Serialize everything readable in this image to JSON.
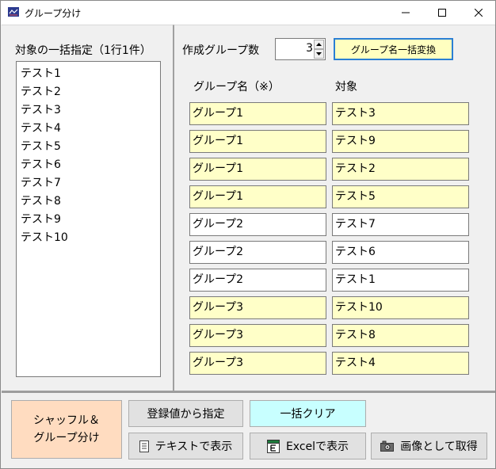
{
  "window": {
    "title": "グループ分け",
    "icon": "app-icon",
    "controls": [
      "minimize-icon",
      "maximize-icon",
      "close-icon"
    ]
  },
  "left": {
    "heading": "対象の一括指定（1行1件）",
    "items": [
      "テスト1",
      "テスト2",
      "テスト3",
      "テスト4",
      "テスト5",
      "テスト6",
      "テスト7",
      "テスト8",
      "テスト9",
      "テスト10"
    ]
  },
  "right": {
    "count_label": "作成グループ数",
    "count_value": "3",
    "convert_button": "グループ名一括変換",
    "col_group": "グループ名（※）",
    "col_target": "対象",
    "rows": [
      {
        "group": "グループ1",
        "target": "テスト3",
        "color": "yellow"
      },
      {
        "group": "グループ1",
        "target": "テスト9",
        "color": "yellow"
      },
      {
        "group": "グループ1",
        "target": "テスト2",
        "color": "yellow"
      },
      {
        "group": "グループ1",
        "target": "テスト5",
        "color": "yellow"
      },
      {
        "group": "グループ2",
        "target": "テスト7",
        "color": "white"
      },
      {
        "group": "グループ2",
        "target": "テスト6",
        "color": "white"
      },
      {
        "group": "グループ2",
        "target": "テスト1",
        "color": "white"
      },
      {
        "group": "グループ3",
        "target": "テスト10",
        "color": "yellow"
      },
      {
        "group": "グループ3",
        "target": "テスト8",
        "color": "yellow"
      },
      {
        "group": "グループ3",
        "target": "テスト4",
        "color": "yellow"
      }
    ]
  },
  "bottom": {
    "shuffle_line1": "シャッフル＆",
    "shuffle_line2": "グループ分け",
    "register": "登録値から指定",
    "clear": "一括クリア",
    "text_view": "テキストで表示",
    "excel_view": "Excelで表示",
    "image_get": "画像として取得"
  },
  "colors": {
    "yellow_cell": "#ffffc8",
    "shuffle_button": "#ffdcc0",
    "clear_button": "#c8ffff",
    "convert_button": "#ffffc0",
    "focus_border": "#2a7fd4"
  }
}
